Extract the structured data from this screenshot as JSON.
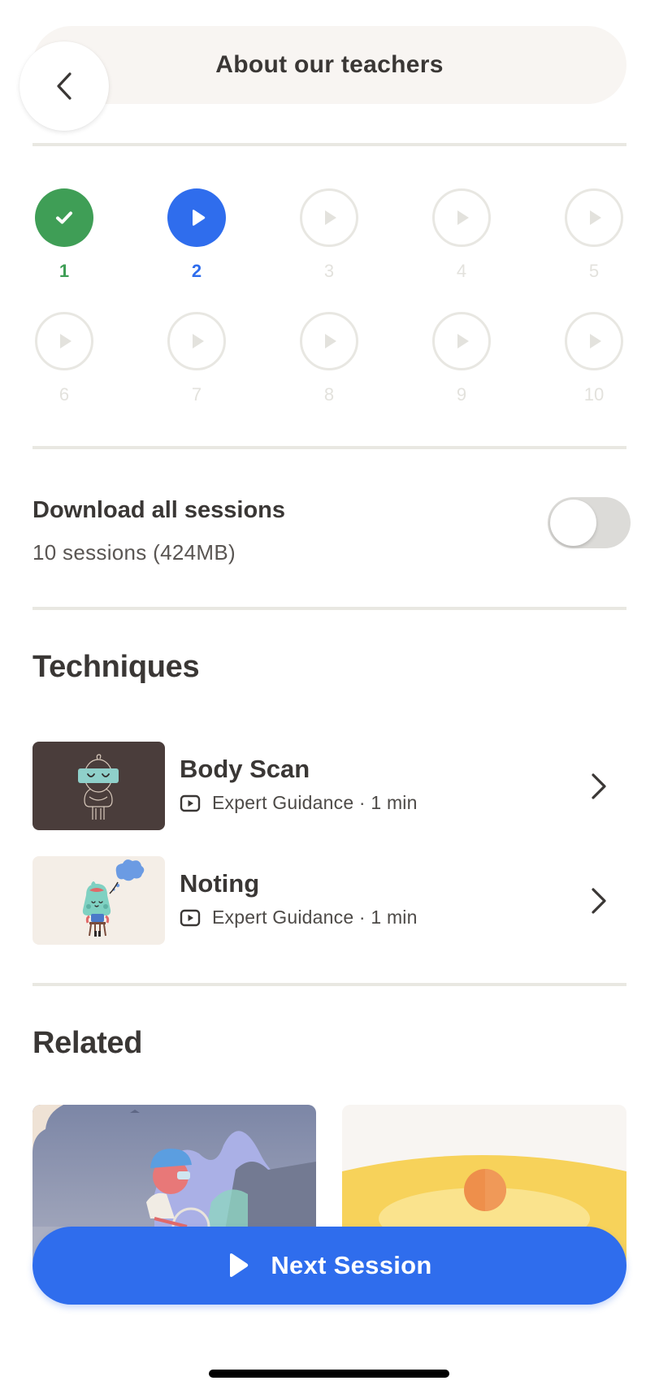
{
  "header": {
    "title": "About our teachers",
    "back_icon": "chevron-left-icon"
  },
  "sessions": [
    {
      "number": "1",
      "status": "completed",
      "icon": "checkmark-icon"
    },
    {
      "number": "2",
      "status": "current",
      "icon": "play-icon"
    },
    {
      "number": "3",
      "status": "locked",
      "icon": "play-icon"
    },
    {
      "number": "4",
      "status": "locked",
      "icon": "play-icon"
    },
    {
      "number": "5",
      "status": "locked",
      "icon": "play-icon"
    },
    {
      "number": "6",
      "status": "locked",
      "icon": "play-icon"
    },
    {
      "number": "7",
      "status": "locked",
      "icon": "play-icon"
    },
    {
      "number": "8",
      "status": "locked",
      "icon": "play-icon"
    },
    {
      "number": "9",
      "status": "locked",
      "icon": "play-icon"
    },
    {
      "number": "10",
      "status": "locked",
      "icon": "play-icon"
    }
  ],
  "download": {
    "title": "Download all sessions",
    "subtitle": "10 sessions (424MB)",
    "enabled": false
  },
  "techniques": {
    "heading": "Techniques",
    "items": [
      {
        "title": "Body Scan",
        "meta": "Expert Guidance · 1 min",
        "thumbnail": "body-scan-illustration"
      },
      {
        "title": "Noting",
        "meta": "Expert Guidance · 1 min",
        "thumbnail": "noting-illustration"
      }
    ]
  },
  "related": {
    "heading": "Related",
    "cards": [
      {
        "thumbnail": "cyclist-mountains-illustration"
      },
      {
        "thumbnail": "sunset-illustration"
      }
    ]
  },
  "cta": {
    "label": "Next Session",
    "icon": "play-icon"
  },
  "colors": {
    "accent": "#2f6ded",
    "completed": "#3f9e56",
    "locked": "#e8e7e2",
    "header_bg": "#f8f5f2",
    "text": "#3a3735"
  }
}
